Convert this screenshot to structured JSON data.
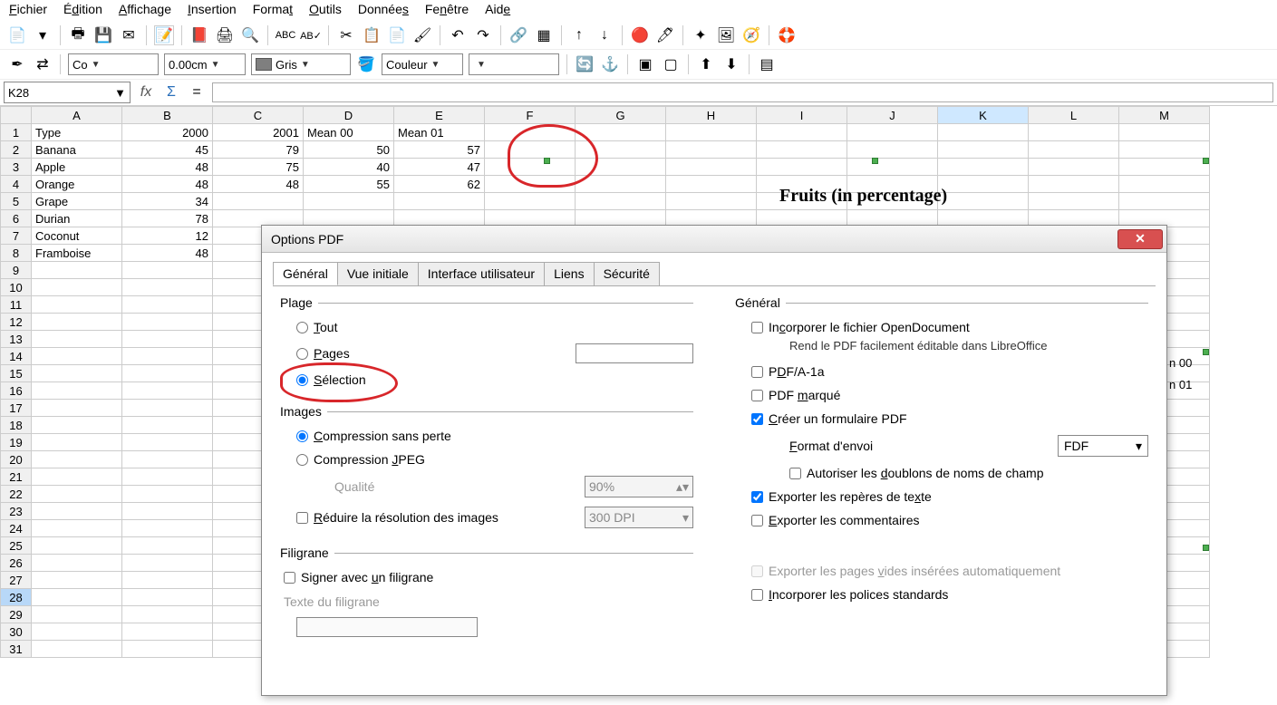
{
  "menu": {
    "fichier": "Fichier",
    "edition": "Édition",
    "affichage": "Affichage",
    "insertion": "Insertion",
    "format": "Format",
    "outils": "Outils",
    "donnees": "Données",
    "fenetre": "Fenêtre",
    "aide": "Aide"
  },
  "toolbar2": {
    "font_combo": "Co",
    "size_combo": "0.00cm",
    "color_name": "Gris",
    "color_label": "Couleur"
  },
  "namebox": "K28",
  "columns": [
    "A",
    "B",
    "C",
    "D",
    "E",
    "F",
    "G",
    "H",
    "I",
    "J",
    "K",
    "L",
    "M"
  ],
  "sheet": {
    "rows": [
      {
        "n": 1,
        "A": "Type",
        "B": "2000",
        "C": "2001",
        "D": "Mean 00",
        "E": "Mean 01"
      },
      {
        "n": 2,
        "A": "Banana",
        "B": "45",
        "C": "79",
        "D": "50",
        "E": "57"
      },
      {
        "n": 3,
        "A": "Apple",
        "B": "48",
        "C": "75",
        "D": "40",
        "E": "47"
      },
      {
        "n": 4,
        "A": "Orange",
        "B": "48",
        "C": "48",
        "D": "55",
        "E": "62"
      },
      {
        "n": 5,
        "A": "Grape",
        "B": "34"
      },
      {
        "n": 6,
        "A": "Durian",
        "B": "78"
      },
      {
        "n": 7,
        "A": "Coconut",
        "B": "12"
      },
      {
        "n": 8,
        "A": "Framboise",
        "B": "48"
      }
    ],
    "empty_rows": [
      9,
      10,
      11,
      12,
      13,
      14,
      15,
      16,
      17,
      18,
      19,
      20,
      21,
      22,
      23,
      24,
      25,
      26,
      27,
      28,
      29,
      30,
      31
    ]
  },
  "chart": {
    "title": "Fruits (in percentage)",
    "legend1": "n 00",
    "legend2": "n 01"
  },
  "dialog": {
    "title": "Options PDF",
    "tabs": {
      "general": "Général",
      "vue": "Vue initiale",
      "interface": "Interface utilisateur",
      "liens": "Liens",
      "securite": "Sécurité"
    },
    "plage": {
      "legend": "Plage",
      "tout": "Tout",
      "pages": "Pages",
      "selection": "Sélection"
    },
    "images": {
      "legend": "Images",
      "lossless": "Compression sans perte",
      "jpeg": "Compression JPEG",
      "quality_label": "Qualité",
      "quality_val": "90%",
      "reduce": "Réduire la résolution des images",
      "dpi": "300 DPI"
    },
    "filigrane": {
      "legend": "Filigrane",
      "signer": "Signer avec un filigrane",
      "texte_label": "Texte du filigrane"
    },
    "general": {
      "legend": "Général",
      "incorporer_od": "Incorporer le fichier OpenDocument",
      "note": "Rend le PDF facilement éditable dans LibreOffice",
      "pdfa": "PDF/A-1a",
      "marque": "PDF marqué",
      "formulaire": "Créer un formulaire PDF",
      "format_label": "Format d'envoi",
      "format_val": "FDF",
      "doublons": "Autoriser les doublons de noms de champ",
      "reperes": "Exporter les repères de texte",
      "commentaires": "Exporter les commentaires",
      "pages_vides": "Exporter les pages vides insérées automatiquement",
      "polices": "Incorporer les polices standards"
    }
  }
}
